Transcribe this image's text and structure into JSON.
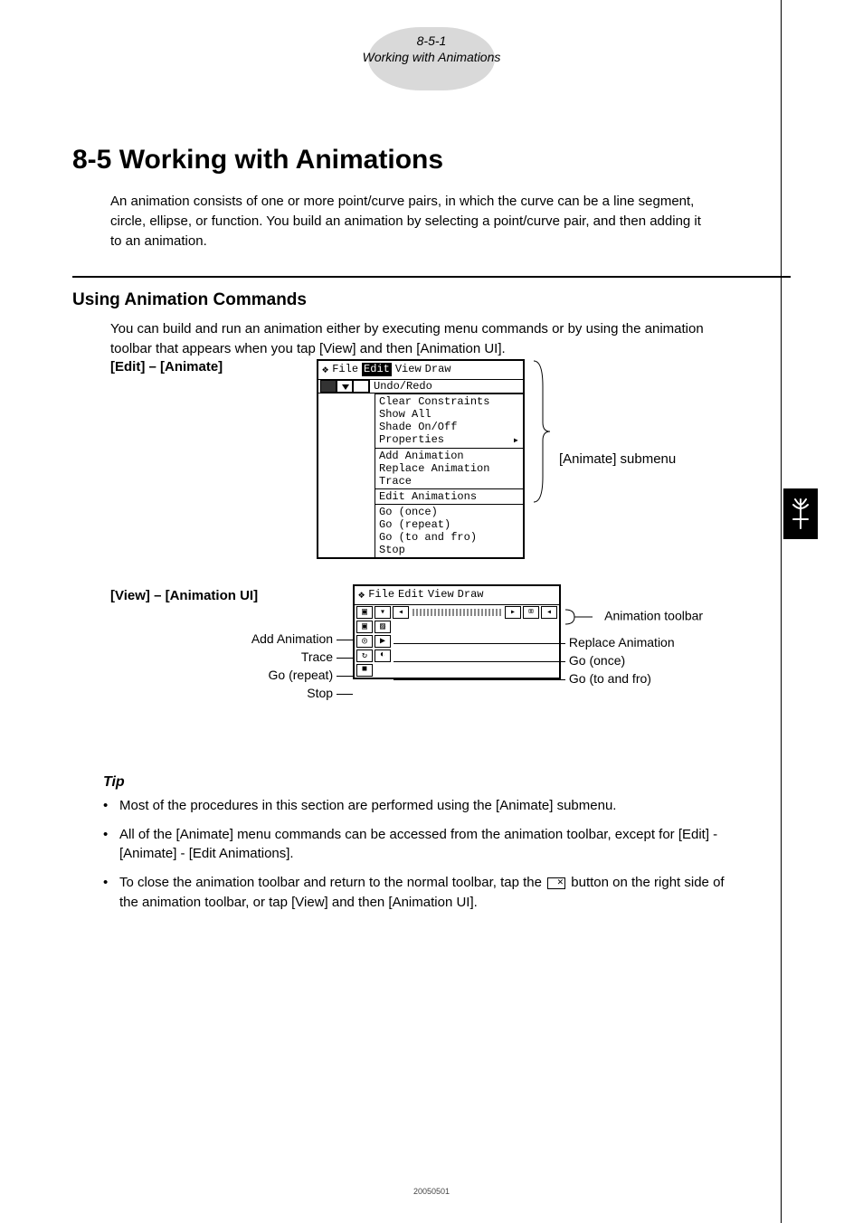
{
  "header": {
    "code": "8-5-1",
    "label": "Working with Animations"
  },
  "title": "8-5  Working with Animations",
  "intro": "An animation consists of one or more point/curve pairs, in which the curve can be a line segment, circle, ellipse, or function. You build an animation by selecting a point/curve pair, and then adding it to an animation.",
  "section": {
    "heading": "Using Animation Commands",
    "intro": "You can build and run an animation either by executing menu commands or by using the animation toolbar that appears when you tap [View] and then [Animation UI]."
  },
  "edit_animate": {
    "label": "[Edit] – [Animate]",
    "menubar": {
      "file": "File",
      "edit": "Edit",
      "view": "View",
      "draw": "Draw"
    },
    "group1": [
      "Undo/Redo"
    ],
    "group2": [
      "Clear Constraints",
      "Show All",
      "Shade On/Off",
      "Properties"
    ],
    "group3": [
      "Add Animation",
      "Replace Animation",
      "Trace"
    ],
    "group4": [
      "Edit Animations"
    ],
    "group5": [
      "Go (once)",
      "Go (repeat)",
      "Go (to and fro)",
      "Stop"
    ],
    "submenu_label": "[Animate] submenu"
  },
  "view_anim_ui": {
    "label": "[View] – [Animation UI]",
    "menubar": {
      "file": "File",
      "edit": "Edit",
      "view": "View",
      "draw": "Draw"
    },
    "left_callouts": [
      "Add Animation",
      "Trace",
      "Go (repeat)",
      "Stop"
    ],
    "right_callouts": {
      "toolbar": "Animation toolbar",
      "replace": "Replace Animation",
      "go_once": "Go (once)",
      "go_tf": "Go (to and fro)"
    },
    "icons": {
      "toggle": "toggle-icon",
      "undo": "undo-icon",
      "left": "left-icon",
      "right": "right-icon",
      "close": "close-x-icon",
      "add": "add-anim-icon",
      "replace": "replace-anim-icon",
      "trace": "trace-icon",
      "play": "play-icon",
      "repeat": "repeat-icon",
      "tofro": "tofro-icon",
      "stop": "stop-icon"
    }
  },
  "tip": {
    "heading": "Tip",
    "items": [
      "Most of the procedures in this section are performed using the [Animate] submenu.",
      "All of the [Animate] menu commands can be accessed from the animation toolbar, except for [Edit] - [Animate] - [Edit Animations].",
      {
        "pre": "To close the animation toolbar and return to the normal toolbar, tap the ",
        "post": " button on the right side of the animation toolbar, or tap [View] and then [Animation UI]."
      }
    ]
  },
  "footer": "20050501"
}
